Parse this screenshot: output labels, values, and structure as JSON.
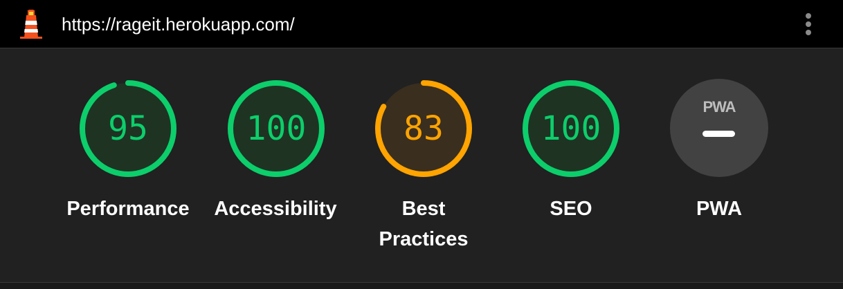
{
  "header": {
    "url": "https://rageit.herokuapp.com/",
    "logo_icon": "lighthouse-icon",
    "menu_icon": "kebab-menu-icon"
  },
  "colors": {
    "pass": "#0cce6b",
    "pass_bg": "#1f3323",
    "average": "#ffa400",
    "average_bg": "#3a2e1f"
  },
  "categories": [
    {
      "label": "Performance",
      "score": "95",
      "fraction": 0.95,
      "status": "pass"
    },
    {
      "label": "Accessibility",
      "score": "100",
      "fraction": 1.0,
      "status": "pass"
    },
    {
      "label": "Best Practices",
      "label_line1": "Best",
      "label_line2": "Practices",
      "score": "83",
      "fraction": 0.83,
      "status": "average"
    },
    {
      "label": "SEO",
      "score": "100",
      "fraction": 1.0,
      "status": "pass"
    }
  ],
  "pwa": {
    "badge_text": "PWA",
    "label": "PWA"
  }
}
